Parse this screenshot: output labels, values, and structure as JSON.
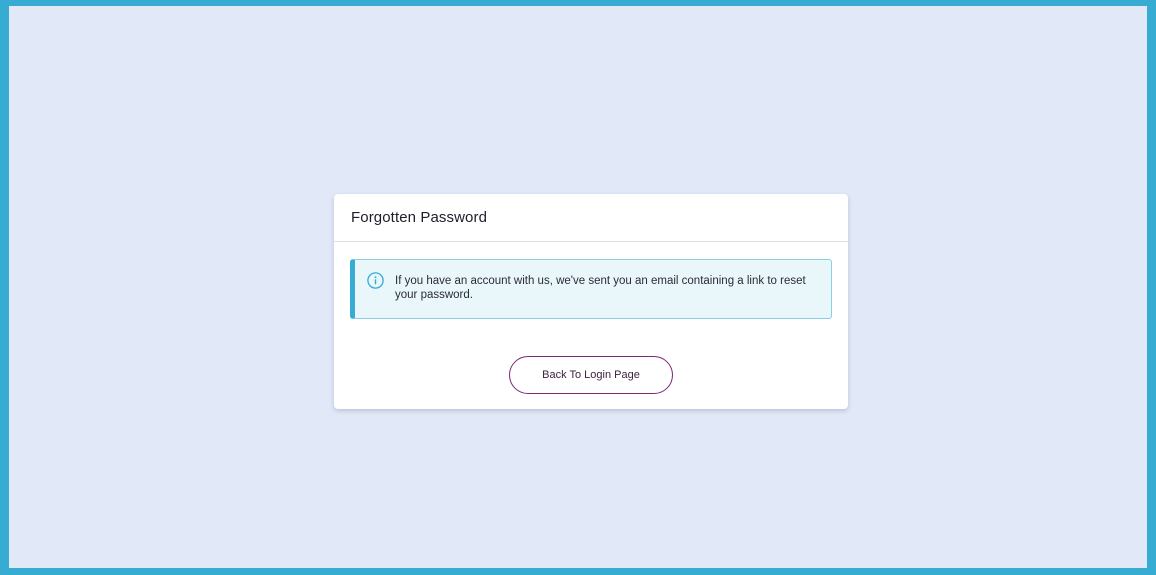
{
  "card": {
    "title": "Forgotten Password"
  },
  "alert": {
    "icon": "info-circle-icon",
    "message": "If you have an account with us, we've sent you an email containing a link to reset your password."
  },
  "actions": {
    "back_label": "Back To Login Page"
  },
  "colors": {
    "frame_border": "#36acd3",
    "page_background": "#e1e8f8",
    "alert_accent": "#36acd3",
    "alert_background": "#e9f6fa",
    "button_border": "#7a2a75"
  }
}
